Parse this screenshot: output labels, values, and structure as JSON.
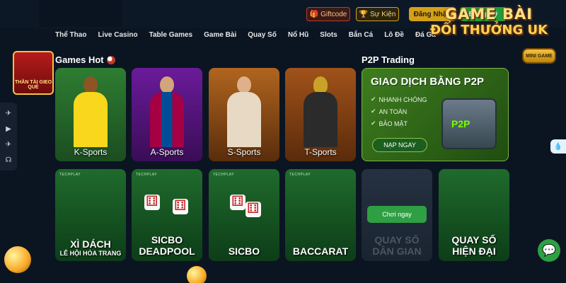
{
  "header": {
    "giftcode_label": "Giftcode",
    "event_label": "Sự Kiện",
    "login_label": "Đăng Nhập",
    "register_label": "Đăng Ký"
  },
  "nav": [
    "Thể Thao",
    "Live Casino",
    "Table Games",
    "Game Bài",
    "Quay Số",
    "Nổ Hũ",
    "Slots",
    "Bắn Cá",
    "Lô Đề",
    "Đá Gà"
  ],
  "brand": {
    "line1": "GAME BÀI",
    "line2": "ĐỔI THƯỞNG UK",
    "badge": "MINI GAME"
  },
  "left_promo": {
    "text": "THẦN TÀI GIEO QUẺ"
  },
  "sections": {
    "games_hot": "Games Hot",
    "p2p": "P2P Trading"
  },
  "sports": [
    {
      "label": "K-Sports",
      "jersey": "#f9d71c"
    },
    {
      "label": "A-Sports",
      "jersey": "#a50044"
    },
    {
      "label": "S-Sports",
      "jersey": "#e8d9c4"
    },
    {
      "label": "T-Sports",
      "jersey": "#2b2b2b"
    }
  ],
  "p2p_card": {
    "heading": "GIAO DỊCH BẰNG P2P",
    "features": [
      "NHANH CHÓNG",
      "AN TOÀN",
      "BẢO MẬT"
    ],
    "cta": "NẠP NGAY",
    "safe_label": "P2P"
  },
  "games": [
    {
      "brand": "TECHPLAY",
      "title": "XÌ DÁCH",
      "subtitle": "LỄ HỘI HÓA TRANG"
    },
    {
      "brand": "TECHPLAY",
      "title": "SICBO",
      "subtitle": "DEADPOOL"
    },
    {
      "brand": "TECHPLAY",
      "title": "SICBO",
      "subtitle": ""
    },
    {
      "brand": "TECHPLAY",
      "title": "BACCARAT",
      "subtitle": ""
    },
    {
      "brand": "",
      "title": "QUAY SỐ",
      "subtitle": "DÂN GIAN",
      "play_label": "Chơi ngay"
    },
    {
      "brand": "",
      "title": "QUAY SỐ",
      "subtitle": "HIỆN ĐẠI"
    }
  ],
  "colors": {
    "accent_green": "#2ea043",
    "gold": "#d4a017",
    "background": "#0b1522"
  }
}
